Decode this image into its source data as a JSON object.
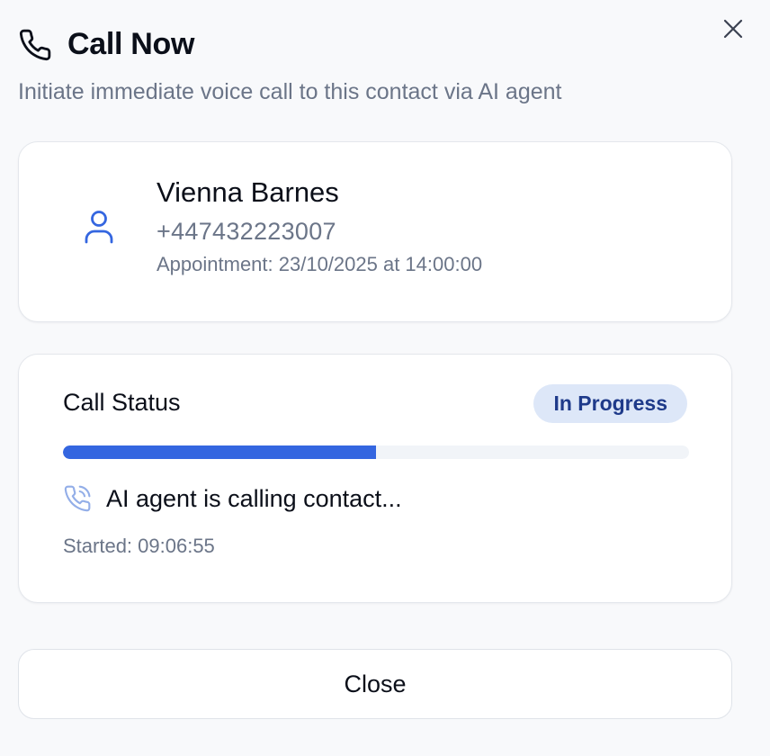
{
  "dialog": {
    "title": "Call Now",
    "subtitle": "Initiate immediate voice call to this contact via AI agent",
    "icon": "phone-icon",
    "close_icon": "close-icon"
  },
  "contact": {
    "name": "Vienna Barnes",
    "phone": "+447432223007",
    "appointment": "Appointment: 23/10/2025 at 14:00:00",
    "icon": "user-icon"
  },
  "call_status": {
    "label": "Call Status",
    "badge": "In Progress",
    "progress": 0.5,
    "message": "AI agent is calling contact...",
    "started": "Started: 09:06:55",
    "icon": "phone-calling-icon"
  },
  "footer": {
    "close_label": "Close"
  },
  "colors": {
    "accent": "#3466e0",
    "badge_bg": "#dde7f8",
    "badge_text": "#1e3a8a",
    "muted_text": "#6b7588"
  }
}
